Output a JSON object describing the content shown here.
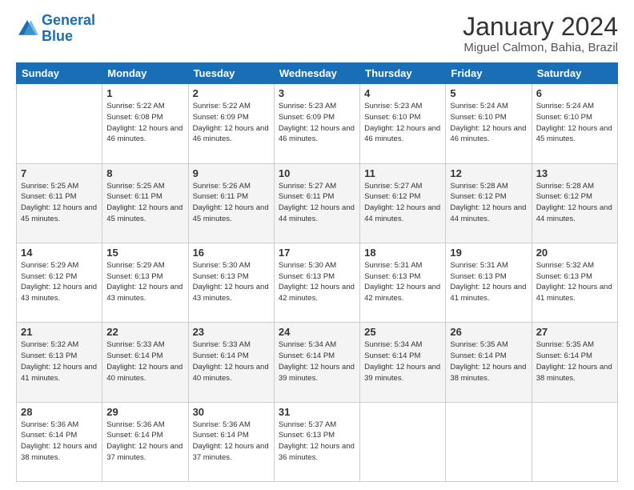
{
  "header": {
    "logo_line1": "General",
    "logo_line2": "Blue",
    "title": "January 2024",
    "subtitle": "Miguel Calmon, Bahia, Brazil"
  },
  "days_of_week": [
    "Sunday",
    "Monday",
    "Tuesday",
    "Wednesday",
    "Thursday",
    "Friday",
    "Saturday"
  ],
  "weeks": [
    [
      {
        "day": "",
        "sunrise": "",
        "sunset": "",
        "daylight": ""
      },
      {
        "day": "1",
        "sunrise": "Sunrise: 5:22 AM",
        "sunset": "Sunset: 6:08 PM",
        "daylight": "Daylight: 12 hours and 46 minutes."
      },
      {
        "day": "2",
        "sunrise": "Sunrise: 5:22 AM",
        "sunset": "Sunset: 6:09 PM",
        "daylight": "Daylight: 12 hours and 46 minutes."
      },
      {
        "day": "3",
        "sunrise": "Sunrise: 5:23 AM",
        "sunset": "Sunset: 6:09 PM",
        "daylight": "Daylight: 12 hours and 46 minutes."
      },
      {
        "day": "4",
        "sunrise": "Sunrise: 5:23 AM",
        "sunset": "Sunset: 6:10 PM",
        "daylight": "Daylight: 12 hours and 46 minutes."
      },
      {
        "day": "5",
        "sunrise": "Sunrise: 5:24 AM",
        "sunset": "Sunset: 6:10 PM",
        "daylight": "Daylight: 12 hours and 46 minutes."
      },
      {
        "day": "6",
        "sunrise": "Sunrise: 5:24 AM",
        "sunset": "Sunset: 6:10 PM",
        "daylight": "Daylight: 12 hours and 45 minutes."
      }
    ],
    [
      {
        "day": "7",
        "sunrise": "Sunrise: 5:25 AM",
        "sunset": "Sunset: 6:11 PM",
        "daylight": "Daylight: 12 hours and 45 minutes."
      },
      {
        "day": "8",
        "sunrise": "Sunrise: 5:25 AM",
        "sunset": "Sunset: 6:11 PM",
        "daylight": "Daylight: 12 hours and 45 minutes."
      },
      {
        "day": "9",
        "sunrise": "Sunrise: 5:26 AM",
        "sunset": "Sunset: 6:11 PM",
        "daylight": "Daylight: 12 hours and 45 minutes."
      },
      {
        "day": "10",
        "sunrise": "Sunrise: 5:27 AM",
        "sunset": "Sunset: 6:11 PM",
        "daylight": "Daylight: 12 hours and 44 minutes."
      },
      {
        "day": "11",
        "sunrise": "Sunrise: 5:27 AM",
        "sunset": "Sunset: 6:12 PM",
        "daylight": "Daylight: 12 hours and 44 minutes."
      },
      {
        "day": "12",
        "sunrise": "Sunrise: 5:28 AM",
        "sunset": "Sunset: 6:12 PM",
        "daylight": "Daylight: 12 hours and 44 minutes."
      },
      {
        "day": "13",
        "sunrise": "Sunrise: 5:28 AM",
        "sunset": "Sunset: 6:12 PM",
        "daylight": "Daylight: 12 hours and 44 minutes."
      }
    ],
    [
      {
        "day": "14",
        "sunrise": "Sunrise: 5:29 AM",
        "sunset": "Sunset: 6:12 PM",
        "daylight": "Daylight: 12 hours and 43 minutes."
      },
      {
        "day": "15",
        "sunrise": "Sunrise: 5:29 AM",
        "sunset": "Sunset: 6:13 PM",
        "daylight": "Daylight: 12 hours and 43 minutes."
      },
      {
        "day": "16",
        "sunrise": "Sunrise: 5:30 AM",
        "sunset": "Sunset: 6:13 PM",
        "daylight": "Daylight: 12 hours and 43 minutes."
      },
      {
        "day": "17",
        "sunrise": "Sunrise: 5:30 AM",
        "sunset": "Sunset: 6:13 PM",
        "daylight": "Daylight: 12 hours and 42 minutes."
      },
      {
        "day": "18",
        "sunrise": "Sunrise: 5:31 AM",
        "sunset": "Sunset: 6:13 PM",
        "daylight": "Daylight: 12 hours and 42 minutes."
      },
      {
        "day": "19",
        "sunrise": "Sunrise: 5:31 AM",
        "sunset": "Sunset: 6:13 PM",
        "daylight": "Daylight: 12 hours and 41 minutes."
      },
      {
        "day": "20",
        "sunrise": "Sunrise: 5:32 AM",
        "sunset": "Sunset: 6:13 PM",
        "daylight": "Daylight: 12 hours and 41 minutes."
      }
    ],
    [
      {
        "day": "21",
        "sunrise": "Sunrise: 5:32 AM",
        "sunset": "Sunset: 6:13 PM",
        "daylight": "Daylight: 12 hours and 41 minutes."
      },
      {
        "day": "22",
        "sunrise": "Sunrise: 5:33 AM",
        "sunset": "Sunset: 6:14 PM",
        "daylight": "Daylight: 12 hours and 40 minutes."
      },
      {
        "day": "23",
        "sunrise": "Sunrise: 5:33 AM",
        "sunset": "Sunset: 6:14 PM",
        "daylight": "Daylight: 12 hours and 40 minutes."
      },
      {
        "day": "24",
        "sunrise": "Sunrise: 5:34 AM",
        "sunset": "Sunset: 6:14 PM",
        "daylight": "Daylight: 12 hours and 39 minutes."
      },
      {
        "day": "25",
        "sunrise": "Sunrise: 5:34 AM",
        "sunset": "Sunset: 6:14 PM",
        "daylight": "Daylight: 12 hours and 39 minutes."
      },
      {
        "day": "26",
        "sunrise": "Sunrise: 5:35 AM",
        "sunset": "Sunset: 6:14 PM",
        "daylight": "Daylight: 12 hours and 38 minutes."
      },
      {
        "day": "27",
        "sunrise": "Sunrise: 5:35 AM",
        "sunset": "Sunset: 6:14 PM",
        "daylight": "Daylight: 12 hours and 38 minutes."
      }
    ],
    [
      {
        "day": "28",
        "sunrise": "Sunrise: 5:36 AM",
        "sunset": "Sunset: 6:14 PM",
        "daylight": "Daylight: 12 hours and 38 minutes."
      },
      {
        "day": "29",
        "sunrise": "Sunrise: 5:36 AM",
        "sunset": "Sunset: 6:14 PM",
        "daylight": "Daylight: 12 hours and 37 minutes."
      },
      {
        "day": "30",
        "sunrise": "Sunrise: 5:36 AM",
        "sunset": "Sunset: 6:14 PM",
        "daylight": "Daylight: 12 hours and 37 minutes."
      },
      {
        "day": "31",
        "sunrise": "Sunrise: 5:37 AM",
        "sunset": "Sunset: 6:13 PM",
        "daylight": "Daylight: 12 hours and 36 minutes."
      },
      {
        "day": "",
        "sunrise": "",
        "sunset": "",
        "daylight": ""
      },
      {
        "day": "",
        "sunrise": "",
        "sunset": "",
        "daylight": ""
      },
      {
        "day": "",
        "sunrise": "",
        "sunset": "",
        "daylight": ""
      }
    ]
  ]
}
